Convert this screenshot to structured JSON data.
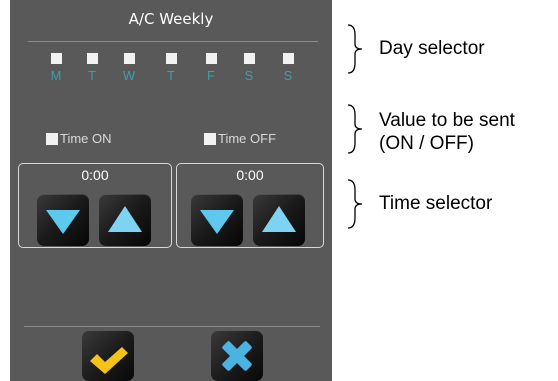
{
  "panel": {
    "title": "A/C Weekly",
    "days": [
      "M",
      "T",
      "W",
      "T",
      "F",
      "S",
      "S"
    ],
    "toggles": {
      "on_label": "Time ON",
      "off_label": "Time OFF"
    },
    "times": {
      "on_value": "0:00",
      "off_value": "0:00"
    }
  },
  "annotations": {
    "day_selector": "Day selector",
    "value_line1": "Value to be sent",
    "value_line2": "(ON / OFF)",
    "time_selector": "Time selector"
  },
  "colors": {
    "panel_bg": "#595959",
    "day_label": "#3aa0a8",
    "arrow_blue": "#5ec8ee",
    "check_yellow": "#f5c218",
    "cross_blue": "#4ab3e2"
  },
  "icons": {
    "down": "triangle-down-icon",
    "up": "triangle-up-icon",
    "confirm": "checkmark-icon",
    "cancel": "cross-icon"
  }
}
